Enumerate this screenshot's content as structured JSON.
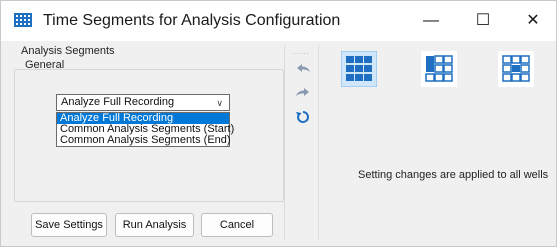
{
  "window": {
    "title": "Time Segments for Analysis Configuration",
    "minimize_glyph": "—",
    "maximize_glyph": "☐",
    "close_glyph": "✕"
  },
  "segments": {
    "label": "Analysis Segments",
    "tab_label": "General",
    "combo_value": "Analyze Full Recording",
    "options": [
      "Analyze Full Recording",
      "Common Analysis Segments (Start)",
      "Common Analysis Segments (End)"
    ],
    "selected_index": 0
  },
  "buttons": {
    "save": "Save Settings",
    "run": "Run Analysis",
    "cancel": "Cancel"
  },
  "toolbar": {
    "grip": "......",
    "icons": [
      "undo-icon",
      "redo-icon",
      "reset-icon"
    ]
  },
  "layouts": {
    "icons": [
      "layout-all-wells-icon",
      "layout-single-well-icon",
      "layout-center-well-icon"
    ],
    "selected_index": 0
  },
  "status_text": "Setting changes are applied to all wells",
  "colors": {
    "accent": "#0078d7",
    "icon_blue": "#1e6fc2",
    "icon_blue_dark": "#0b4f9c",
    "disabled_gray": "#8a9bb0"
  }
}
